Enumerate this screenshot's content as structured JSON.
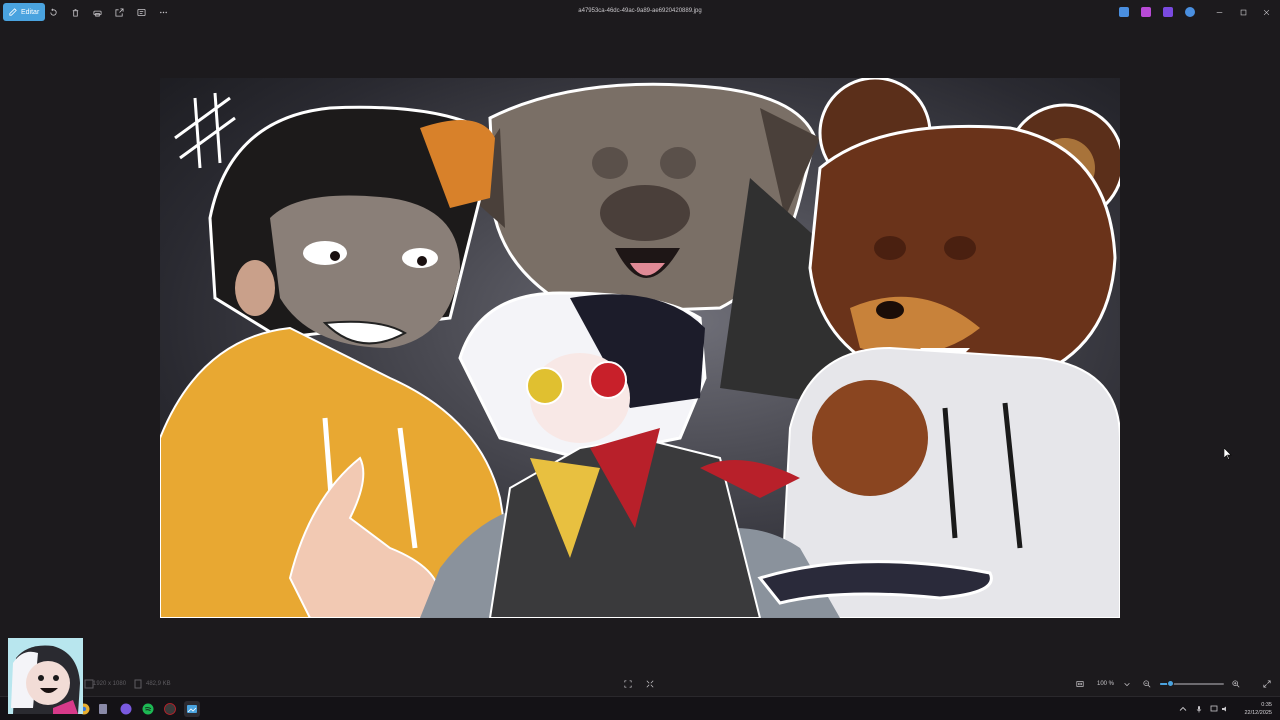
{
  "toolbar": {
    "edit_label": "Editar",
    "tools": [
      "rotate-icon",
      "delete-icon",
      "print-icon",
      "share-icon",
      "info-icon",
      "more-icon"
    ]
  },
  "window": {
    "title": "a47953ca-46dc-49ac-9a89-ae6920420889.jpg",
    "extensions": [
      {
        "name": "edit-icon",
        "color": "#4a8fe0"
      },
      {
        "name": "clipchamp-icon",
        "color": "#b84ad6"
      },
      {
        "name": "designer-icon",
        "color": "#7a4ae0"
      },
      {
        "name": "onedrive-icon",
        "color": "#4a8fe0"
      }
    ]
  },
  "status": {
    "dimensions": "1920 x 1080",
    "file_size": "482,9 KB",
    "zoom": "100 %",
    "zoom_level_percent": 17
  },
  "taskbar": {
    "time": "0:35",
    "date": "22/12/2025"
  },
  "colors": {
    "accent": "#4aa3df",
    "background": "#1c1a1d"
  }
}
